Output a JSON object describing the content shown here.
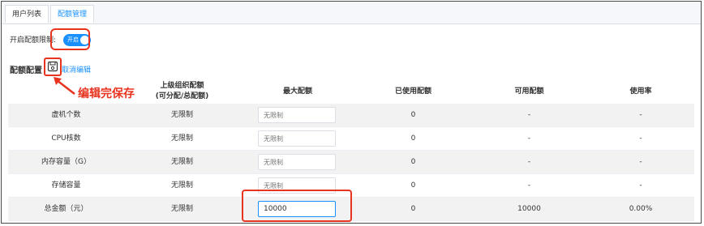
{
  "tabs": [
    {
      "label": "用户列表",
      "active": false
    },
    {
      "label": "配额管理",
      "active": true
    }
  ],
  "toggle": {
    "label": "开启配额限制:",
    "switch_text": "开启",
    "on": true
  },
  "section": {
    "title": "配额配置",
    "cancel_label": "取消编辑",
    "save_icon": "save-icon"
  },
  "annotation": {
    "text": "编辑完保存"
  },
  "table": {
    "headers": [
      {
        "line1": "",
        "line2": ""
      },
      {
        "line1": "上级组织配额",
        "line2": "(可分配/总配额)"
      },
      {
        "line1": "最大配额",
        "line2": ""
      },
      {
        "line1": "已使用配额",
        "line2": ""
      },
      {
        "line1": "可用配额",
        "line2": ""
      },
      {
        "line1": "使用率",
        "line2": ""
      }
    ],
    "rows": [
      {
        "name": "虚机个数",
        "parent": "无限制",
        "max_value": "",
        "max_placeholder": "无限制",
        "used": "0",
        "available": "-",
        "usage": "-"
      },
      {
        "name": "CPU核数",
        "parent": "无限制",
        "max_value": "",
        "max_placeholder": "无限制",
        "used": "0",
        "available": "-",
        "usage": "-"
      },
      {
        "name": "内存容量（G）",
        "parent": "无限制",
        "max_value": "",
        "max_placeholder": "无限制",
        "used": "0",
        "available": "-",
        "usage": "-"
      },
      {
        "name": "存储容量",
        "parent": "无限制",
        "max_value": "",
        "max_placeholder": "无限制",
        "used": "0",
        "available": "-",
        "usage": "-"
      },
      {
        "name": "总金额（元）",
        "parent": "无限制",
        "max_value": "10000",
        "max_placeholder": "",
        "used": "0",
        "available": "10000",
        "usage": "0.00%"
      }
    ]
  },
  "colors": {
    "accent": "#1890ff",
    "highlight": "#e8331f",
    "row_alt": "#f2f2f2"
  }
}
